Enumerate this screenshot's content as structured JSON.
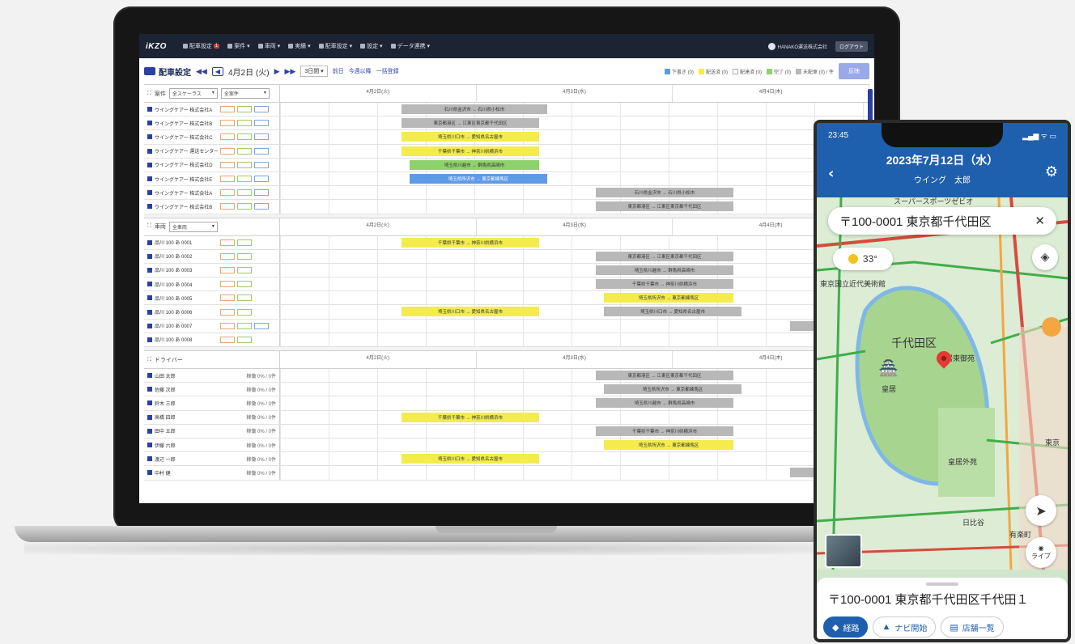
{
  "web": {
    "nav": {
      "logo": "iKZO",
      "items": [
        {
          "label": "配車設定",
          "badge": "1"
        },
        {
          "label": "案件 ▾"
        },
        {
          "label": "車両 ▾"
        },
        {
          "label": "実績 ▾"
        },
        {
          "label": "配車設定 ▾"
        },
        {
          "label": "設定 ▾"
        },
        {
          "label": "データ連携 ▾"
        }
      ],
      "user": "HANAKO運送株式会社",
      "logout": "ログアウト"
    },
    "toolbar": {
      "title": "配車設定",
      "date": "4月2日 (火)",
      "range": "3日間 ▾",
      "links": [
        "前日",
        "今週以降",
        "一括登録"
      ],
      "legend": [
        {
          "label": "下書き (0)",
          "color": "#5e9ae6"
        },
        {
          "label": "配送済 (0)",
          "color": "#f3ec4c"
        },
        {
          "label": "配達済 (0)",
          "color": "#ffffff"
        },
        {
          "label": "完了 (0)",
          "color": "#8fd16a"
        },
        {
          "label": "未配車 (0) / 件",
          "color": "#b8b8b8"
        }
      ],
      "apply": "反映"
    },
    "days": [
      "4月2日(火)",
      "4月3日(水)",
      "4月4日(木)"
    ],
    "sections": [
      {
        "header": "案件",
        "filter": "全スケーラス",
        "filter2": "全案件",
        "rows": [
          {
            "name": "ウイングケアー 株式会社A",
            "chips": [
              "o",
              "g",
              "b"
            ],
            "bars": [
              {
                "l": 150,
                "w": 180,
                "c": "gray",
                "t": "石川県金沢市 → 石川県小松市"
              }
            ]
          },
          {
            "name": "ウイングケアー 株式会社B",
            "chips": [
              "o",
              "g",
              "b"
            ],
            "bars": [
              {
                "l": 150,
                "w": 170,
                "c": "gray",
                "t": "東京都港区 → 江東区東京都千代田区"
              }
            ]
          },
          {
            "name": "ウイングケアー 株式会社C",
            "chips": [
              "o",
              "g",
              "b"
            ],
            "bars": [
              {
                "l": 150,
                "w": 170,
                "c": "yellow",
                "t": "埼玉県川口市 → 愛知県名古屋市"
              }
            ]
          },
          {
            "name": "ウイングケアー 運送センター",
            "chips": [
              "o",
              "g",
              "b"
            ],
            "bars": [
              {
                "l": 150,
                "w": 170,
                "c": "yellow",
                "t": "千葉県千葉市 → 神奈川県横浜市"
              }
            ]
          },
          {
            "name": "ウイングケアー 株式会社D",
            "chips": [
              "o",
              "g",
              "b"
            ],
            "bars": [
              {
                "l": 160,
                "w": 160,
                "c": "green",
                "t": "埼玉県川越市 → 群馬県高崎市"
              }
            ]
          },
          {
            "name": "ウイングケアー 株式会社E",
            "chips": [
              "o",
              "g",
              "b"
            ],
            "bars": [
              {
                "l": 160,
                "w": 170,
                "c": "blue",
                "t": "埼玉県所沢市 → 東京都練馬区"
              }
            ]
          },
          {
            "name": "ウイングケアー 株式会社A",
            "chips": [
              "o",
              "g",
              "b"
            ],
            "bars": [
              {
                "l": 390,
                "w": 170,
                "c": "gray",
                "t": "石川県金沢市 → 石川県小松市"
              }
            ]
          },
          {
            "name": "ウイングケアー 株式会社B",
            "chips": [
              "o",
              "g",
              "b"
            ],
            "bars": [
              {
                "l": 390,
                "w": 170,
                "c": "gray",
                "t": "東京都港区 → 江東区東京都千代田区"
              }
            ]
          }
        ]
      },
      {
        "header": "車両",
        "filter": "全車両",
        "rows": [
          {
            "name": "品川 100 あ 0001",
            "chips": [
              "o",
              "g"
            ],
            "bars": [
              {
                "l": 150,
                "w": 170,
                "c": "yellow",
                "t": "千葉県千葉市 → 神奈川県横浜市"
              }
            ]
          },
          {
            "name": "品川 100 あ 0002",
            "chips": [
              "o",
              "g"
            ],
            "bars": [
              {
                "l": 390,
                "w": 170,
                "c": "gray",
                "t": "東京都港区 → 江東区東京都千代田区"
              }
            ]
          },
          {
            "name": "品川 100 あ 0003",
            "chips": [
              "o",
              "g"
            ],
            "bars": [
              {
                "l": 390,
                "w": 170,
                "c": "gray",
                "t": "埼玉県川越市 → 群馬県高崎市"
              }
            ]
          },
          {
            "name": "品川 100 あ 0004",
            "chips": [
              "o",
              "g"
            ],
            "bars": [
              {
                "l": 390,
                "w": 170,
                "c": "gray",
                "t": "千葉県千葉市 → 神奈川県横浜市"
              }
            ]
          },
          {
            "name": "品川 100 あ 0005",
            "chips": [
              "o",
              "g"
            ],
            "bars": [
              {
                "l": 400,
                "w": 160,
                "c": "yellow",
                "t": "埼玉県所沢市 → 東京都練馬区"
              }
            ]
          },
          {
            "name": "品川 100 あ 0006",
            "chips": [
              "o",
              "g"
            ],
            "bars": [
              {
                "l": 150,
                "w": 170,
                "c": "yellow",
                "t": "埼玉県川口市 → 愛知県名古屋市"
              },
              {
                "l": 400,
                "w": 170,
                "c": "gray",
                "t": "埼玉県川口市 → 愛知県名古屋市"
              }
            ]
          },
          {
            "name": "品川 100 あ 0007",
            "chips": [
              "o",
              "g",
              "b"
            ],
            "bars": [
              {
                "l": 630,
                "w": 30,
                "c": "gray",
                "t": ""
              }
            ]
          },
          {
            "name": "品川 100 あ 0008",
            "chips": [
              "o",
              "g"
            ],
            "bars": []
          }
        ]
      },
      {
        "header": "ドライバー",
        "rows": [
          {
            "name": "山田 太郎",
            "util": "稼働 0% / 0件",
            "bars": [
              {
                "l": 390,
                "w": 170,
                "c": "gray",
                "t": "東京都港区 → 江東区東京都千代田区"
              }
            ]
          },
          {
            "name": "佐藤 次郎",
            "util": "稼働 0% / 0件",
            "bars": [
              {
                "l": 400,
                "w": 170,
                "c": "gray",
                "t": "埼玉県所沢市 → 東京都練馬区"
              }
            ]
          },
          {
            "name": "鈴木 三郎",
            "util": "稼働 0% / 0件",
            "bars": [
              {
                "l": 390,
                "w": 170,
                "c": "gray",
                "t": "埼玉県川越市 → 群馬県高崎市"
              }
            ]
          },
          {
            "name": "高橋 四郎",
            "util": "稼働 0% / 0件",
            "bars": [
              {
                "l": 150,
                "w": 170,
                "c": "yellow",
                "t": "千葉県千葉市 → 神奈川県横浜市"
              }
            ]
          },
          {
            "name": "田中 五郎",
            "util": "稼働 0% / 0件",
            "bars": [
              {
                "l": 390,
                "w": 170,
                "c": "gray",
                "t": "千葉県千葉市 → 神奈川県横浜市"
              }
            ]
          },
          {
            "name": "伊藤 六郎",
            "util": "稼働 0% / 0件",
            "bars": [
              {
                "l": 400,
                "w": 160,
                "c": "yellow",
                "t": "埼玉県所沢市 → 東京都練馬区"
              }
            ]
          },
          {
            "name": "渡辺 一郎",
            "util": "稼働 0% / 0件",
            "bars": [
              {
                "l": 150,
                "w": 170,
                "c": "yellow",
                "t": "埼玉県川口市 → 愛知県名古屋市"
              }
            ]
          },
          {
            "name": "中村 健",
            "util": "稼働 0% / 0件",
            "bars": [
              {
                "l": 630,
                "w": 30,
                "c": "gray",
                "t": ""
              }
            ]
          }
        ]
      }
    ]
  },
  "phone": {
    "time": "23:45",
    "signal": "▂▄▆ ᯤ ▭",
    "date": "2023年7月12日（水）",
    "driver": "ウイング　太郎",
    "search": "〒100-0001 東京都千代田区",
    "weather": "33°",
    "map_labels": {
      "area": "千代田区",
      "palace": "皇居",
      "pin_label": "皇居東御苑",
      "gaien": "皇居外苑",
      "hibiya": "日比谷",
      "yurakucho": "有楽町",
      "tokyo": "東京",
      "museum": "東京国立近代美術館",
      "sports": "スーパースポーツゼビオ"
    },
    "live": "ライブ",
    "address": "〒100-0001 東京都千代田区千代田１",
    "actions": {
      "route": "経路",
      "navi": "ナビ開始",
      "stores": "店舗一覧"
    }
  }
}
